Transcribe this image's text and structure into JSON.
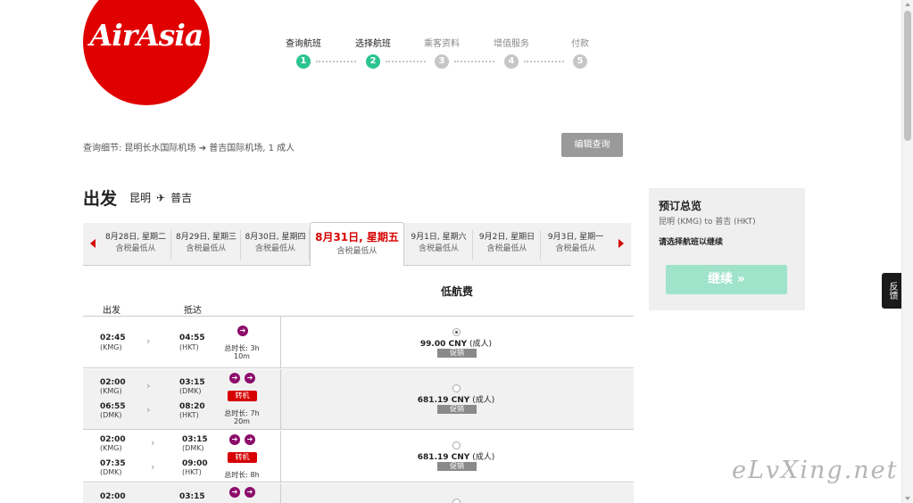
{
  "logo": {
    "text": "AirAsia"
  },
  "steps": [
    {
      "label": "查询航班",
      "num": "1",
      "state": "done"
    },
    {
      "label": "选择航班",
      "num": "2",
      "state": "current"
    },
    {
      "label": "乘客资料",
      "num": "3",
      "state": "pending"
    },
    {
      "label": "增值服务",
      "num": "4",
      "state": "pending"
    },
    {
      "label": "付款",
      "num": "5",
      "state": "pending"
    }
  ],
  "query": {
    "details": "查询细节: 昆明长水国际机场 ➔ 普吉国际机场, 1 成人",
    "edit_label": "编辑查询"
  },
  "departure": {
    "title": "出发",
    "origin": "昆明",
    "arrow": "✈",
    "destination": "普吉"
  },
  "dates": [
    {
      "date": "8月28日, 星期二",
      "sub": "含税最低从"
    },
    {
      "date": "8月29日, 星期三",
      "sub": "含税最低从"
    },
    {
      "date": "8月30日, 星期四",
      "sub": "含税最低从"
    },
    {
      "date": "8月31日, 星期五",
      "sub": "含税最低从",
      "active": true
    },
    {
      "date": "9月1日, 星期六",
      "sub": "含税最低从"
    },
    {
      "date": "9月2日, 星期日",
      "sub": "含税最低从"
    },
    {
      "date": "9月3日, 星期一",
      "sub": "含税最低从"
    }
  ],
  "table": {
    "col_depart": "出发",
    "col_arrive": "抵达",
    "fare_header": "低航费",
    "rows": [
      {
        "dep1_time": "02:45",
        "dep1_code": "(KMG)",
        "arr1_time": "04:55",
        "arr1_code": "(HKT)",
        "duration_label": "总时长: 3h",
        "duration_rest": "10m",
        "price": "99.00 CNY",
        "pax": "(成人)",
        "promo": "促销",
        "selected": true
      },
      {
        "dep1_time": "02:00",
        "dep1_code": "(KMG)",
        "arr1_time": "03:15",
        "arr1_code": "(DMK)",
        "dep2_time": "06:55",
        "dep2_code": "(DMK)",
        "arr2_time": "08:20",
        "arr2_code": "(HKT)",
        "transfer": "转机",
        "duration_label": "总时长: 7h",
        "duration_rest": "20m",
        "price": "681.19 CNY",
        "pax": "(成人)",
        "promo": "促销"
      },
      {
        "dep1_time": "02:00",
        "dep1_code": "(KMG)",
        "arr1_time": "03:15",
        "arr1_code": "(DMK)",
        "dep2_time": "07:35",
        "dep2_code": "(DMK)",
        "arr2_time": "09:00",
        "arr2_code": "(HKT)",
        "transfer": "转机",
        "duration_label": "总时长: 8h",
        "price": "681.19 CNY",
        "pax": "(成人)",
        "promo": "促销"
      },
      {
        "dep1_time": "02:00",
        "arr1_time": "03:15"
      }
    ]
  },
  "summary": {
    "title": "预订总览",
    "route": "昆明 (KMG) to 普吉 (HKT)",
    "hint": "请选择航班以继续",
    "continue_label": "继续 »"
  },
  "feedback_label": "反馈",
  "watermark": "eLvXing.net",
  "colors": {
    "brand_red": "#e10000",
    "step_green": "#2bc48f",
    "continue_green": "#9fe3cb",
    "transfer_red": "#d70000",
    "plane_purple": "#8c0c6a"
  }
}
